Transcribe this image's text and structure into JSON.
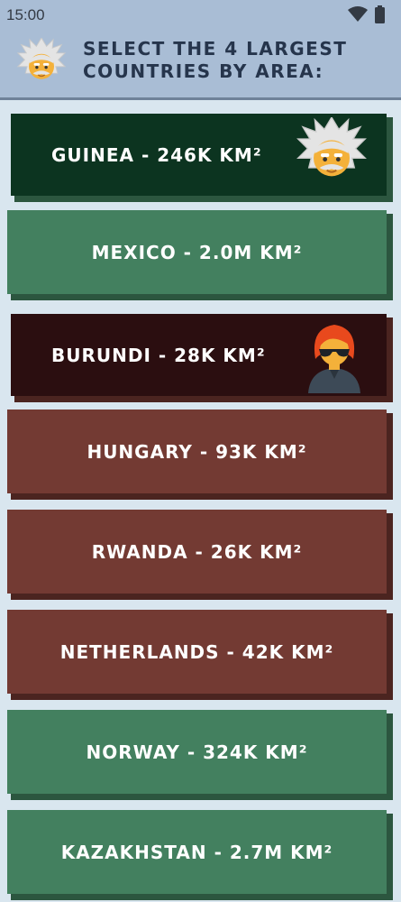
{
  "status_bar": {
    "time": "15:00",
    "icons": [
      "wifi-icon",
      "battery-icon"
    ]
  },
  "header": {
    "avatar": "einstein-avatar-icon",
    "title": "Select the 4 largest countries by area:"
  },
  "colors": {
    "green": "#43805f",
    "green_dark": "#2c563f",
    "red": "#733a33",
    "red_dark": "#4b2420",
    "selected_green": "#0c3420",
    "selected_red": "#2b0e10"
  },
  "options": [
    {
      "label": "Guinea - 246K km²",
      "state": "selected",
      "color": "green",
      "avatar": "einstein-avatar-icon"
    },
    {
      "label": "Mexico - 2.0M km²",
      "state": "revealed",
      "color": "green"
    },
    {
      "label": "Burundi - 28K km²",
      "state": "selected",
      "color": "red",
      "avatar": "player-avatar-icon"
    },
    {
      "label": "Hungary - 93K km²",
      "state": "revealed",
      "color": "red"
    },
    {
      "label": "Rwanda - 26K km²",
      "state": "revealed",
      "color": "red"
    },
    {
      "label": "Netherlands - 42K km²",
      "state": "revealed",
      "color": "red"
    },
    {
      "label": "Norway - 324K km²",
      "state": "revealed",
      "color": "green"
    },
    {
      "label": "Kazakhstan - 2.7M km²",
      "state": "revealed",
      "color": "green"
    }
  ]
}
